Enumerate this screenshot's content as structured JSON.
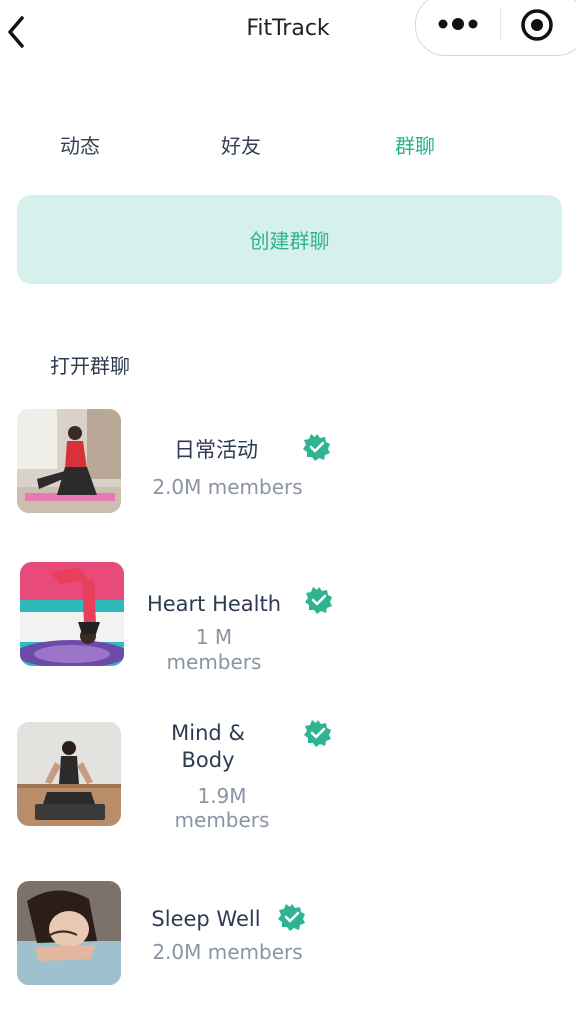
{
  "header": {
    "title": "FitTrack"
  },
  "tabs": [
    {
      "label": "动态",
      "active": false
    },
    {
      "label": "好友",
      "active": false
    },
    {
      "label": "群聊",
      "active": true
    }
  ],
  "create_group": {
    "label": "创建群聊"
  },
  "section": {
    "title": "打开群聊"
  },
  "groups": [
    {
      "name": "日常活动",
      "members": "2.0M members",
      "verified": true
    },
    {
      "name": "Heart Health",
      "members_line1": "1 M",
      "members_line2": "members",
      "verified": true
    },
    {
      "name_line1": "Mind &",
      "name_line2": "Body",
      "members_line1": "1.9M",
      "members_line2": "members",
      "verified": true
    },
    {
      "name": "Sleep Well",
      "members": "2.0M members",
      "verified": true
    }
  ],
  "colors": {
    "accent": "#26b38f",
    "button_bg": "#d6f0eb",
    "badge": "#2fb393",
    "muted": "#8a94a3"
  }
}
